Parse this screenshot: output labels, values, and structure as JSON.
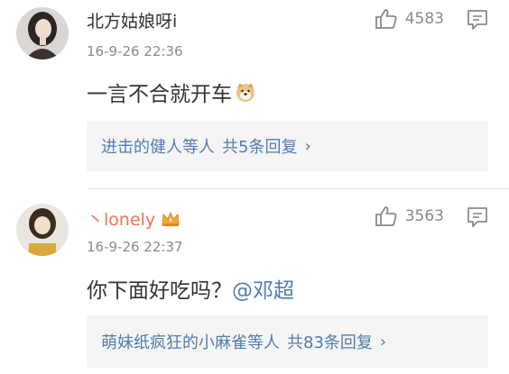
{
  "comments": [
    {
      "username": "北方姑娘呀i",
      "time": "16-9-26 22:36",
      "text": "一言不合就开车",
      "likes": "4583",
      "replies": {
        "users": "进击的健人等人",
        "count": "共5条回复",
        "chevron": "›"
      },
      "emoji": "doge-emoji"
    },
    {
      "username": "丶lonely",
      "time": "16-9-26 22:37",
      "text": "你下面好吃吗？",
      "mention": "@邓超",
      "likes": "3563",
      "replies": {
        "users": "萌妹纸疯狂的小麻雀等人",
        "count": "共83条回复",
        "chevron": "›"
      },
      "badge": "crown-icon"
    }
  ],
  "colors": {
    "text": "#333333",
    "meta": "#8a8a8a",
    "link": "#507daf",
    "vip_name": "#eb7350",
    "reply_bg": "#f5f5f5"
  }
}
